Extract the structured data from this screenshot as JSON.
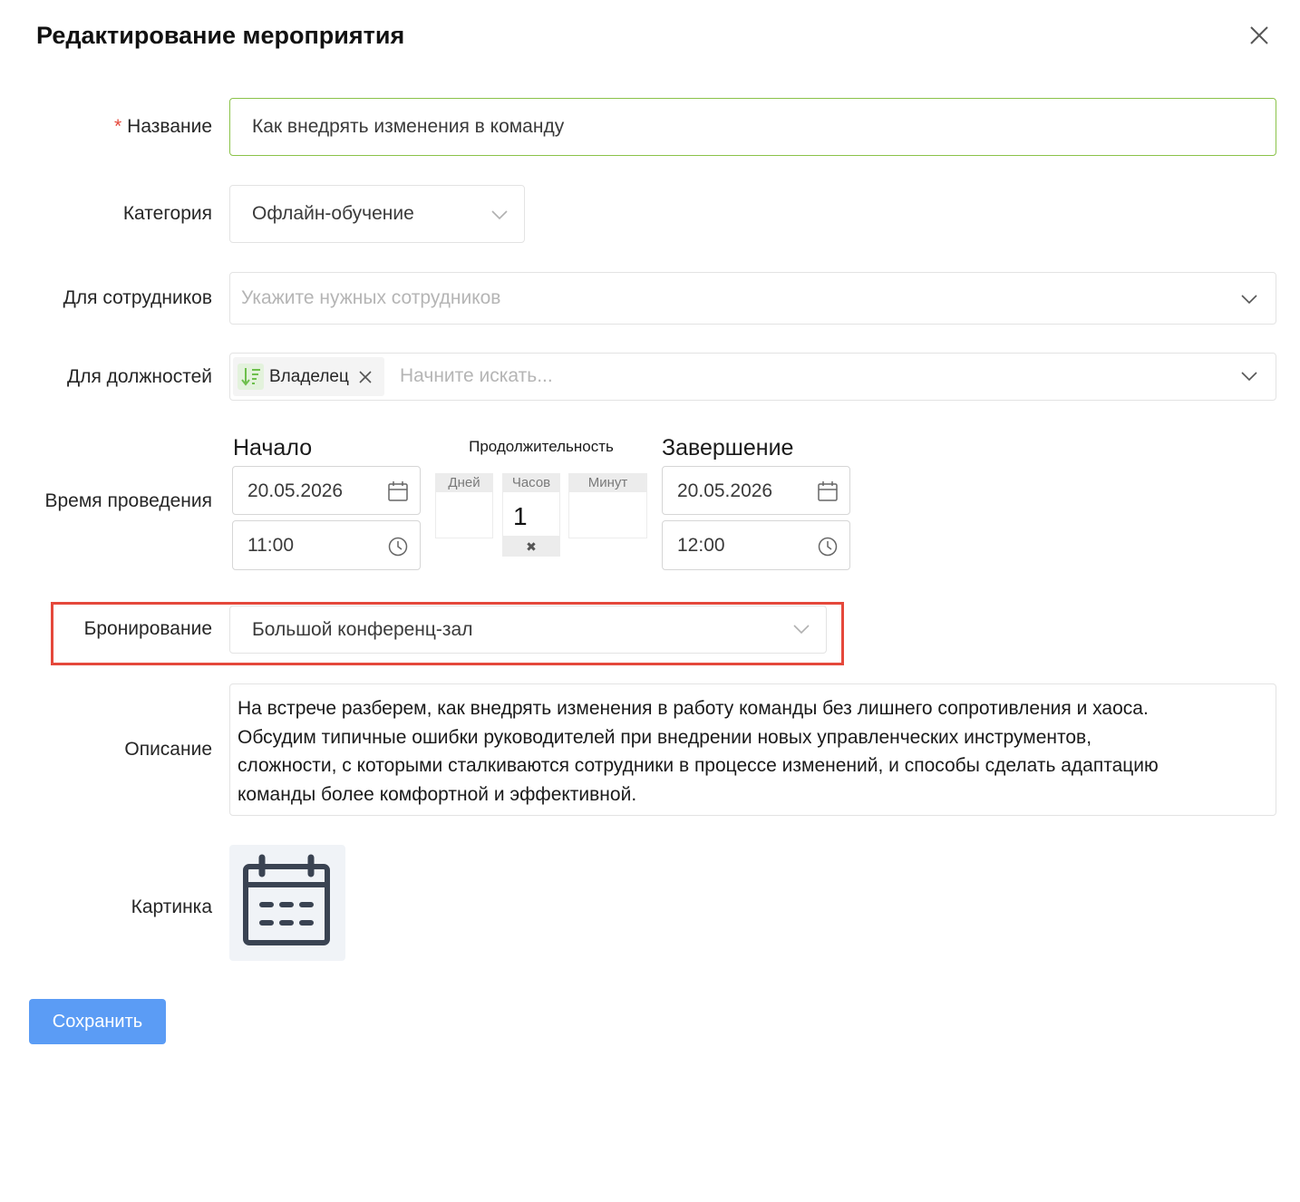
{
  "dialog": {
    "title": "Редактирование мероприятия"
  },
  "form": {
    "name": {
      "label": "Название",
      "required_mark": "*",
      "value": "Как внедрять изменения в команду"
    },
    "category": {
      "label": "Категория",
      "value": "Офлайн-обучение"
    },
    "employees": {
      "label": "Для сотрудников",
      "placeholder": "Укажите нужных сотрудников"
    },
    "positions": {
      "label": "Для должностей",
      "tag": "Владелец",
      "placeholder": "Начните искать..."
    },
    "time": {
      "label": "Время проведения",
      "start_label": "Начало",
      "start_date": "20.05.2026",
      "start_time": "11:00",
      "duration_label": "Продолжительность",
      "days_label": "Дней",
      "hours_label": "Часов",
      "hours_value": "1",
      "minutes_label": "Минут",
      "clear_mark": "✖",
      "end_label": "Завершение",
      "end_date": "20.05.2026",
      "end_time": "12:00"
    },
    "booking": {
      "label": "Бронирование",
      "value": "Большой конференц-зал",
      "highlight_color": "#e5483b"
    },
    "description": {
      "label": "Описание",
      "lines": [
        "На встрече разберем, как внедрять изменения в работу команды без лишнего сопротивления и хаоса.",
        "Обсудим типичные ошибки руководителей при внедрении новых управленческих инструментов,",
        "сложности, с которыми сталкиваются сотрудники в процессе изменений, и способы сделать адаптацию",
        "команды более комфортной и эффективной."
      ]
    },
    "picture": {
      "label": "Картинка",
      "icon": "calendar-icon"
    }
  },
  "actions": {
    "save_label": "Сохранить",
    "save_color": "#5b9cf5"
  },
  "colors": {
    "focus_border": "#8bc34a",
    "tag_icon": "#6dbf4b"
  }
}
